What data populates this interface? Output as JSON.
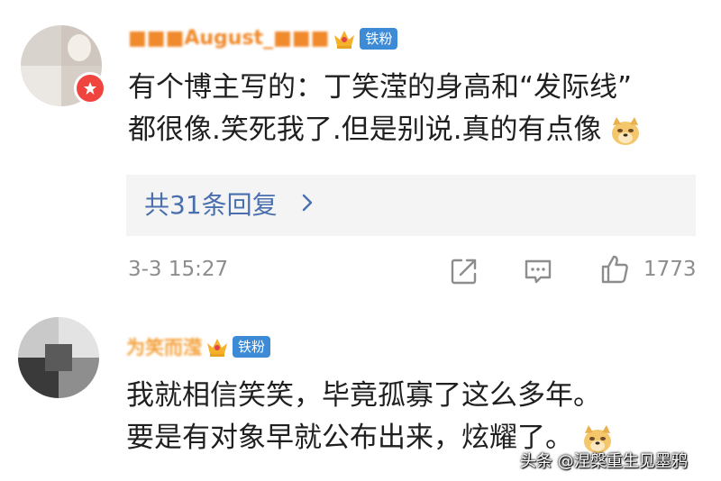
{
  "comments": [
    {
      "username": "■■■August_■■■",
      "fan_badge": "铁粉",
      "text_line1": "有个博主写的：丁笑滢的身高和“发际线”",
      "text_line2": "都很像.笑死我了.但是别说.真的有点像",
      "emoji": "doge",
      "reply_label": "共31条回复",
      "timestamp": "3-3 15:27",
      "like_count": "1773"
    },
    {
      "username": "为笑而滢",
      "fan_badge": "铁粉",
      "text_line1": "我就相信笑笑，毕竟孤寡了这么多年。",
      "text_line2": "要是有对象早就公布出来，炫耀了。",
      "emoji": "doge"
    }
  ],
  "watermark": "头条 @涅槃重生见墨鸦",
  "colors": {
    "reply_link": "#4a6fae",
    "fan_badge_bg": "#3d8ad6",
    "vip_badge": "#f0453f",
    "meta_text": "#8d8d8d"
  },
  "icons": [
    "crown-icon",
    "share-icon",
    "comment-icon",
    "like-icon",
    "chevron-right-icon",
    "doge-emoji-icon"
  ]
}
